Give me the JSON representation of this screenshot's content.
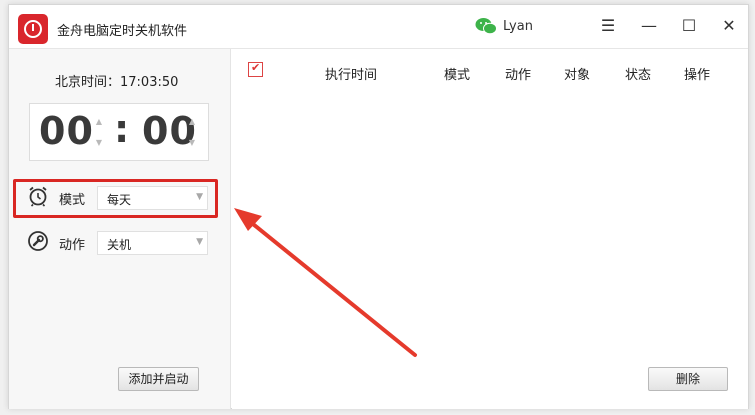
{
  "titlebar": {
    "app_title": "金舟电脑定时关机软件",
    "user_name": "Lyan",
    "icons": [
      "app-logo-icon",
      "wechat-icon",
      "menu-icon",
      "minimize-icon",
      "maximize-icon",
      "close-icon"
    ]
  },
  "left": {
    "beijing_time": "北京时间：17:03:50",
    "timer": {
      "hours": "00",
      "colon": ":",
      "minutes": "00"
    },
    "mode": {
      "label": "模式",
      "value": "每天",
      "icon": "alarm-clock-icon"
    },
    "action": {
      "label": "动作",
      "value": "关机",
      "icon": "wrench-icon"
    },
    "add_start_button": "添加并启动"
  },
  "table": {
    "columns": [
      "执行时间",
      "模式",
      "动作",
      "对象",
      "状态",
      "操作"
    ],
    "rows": [],
    "select_all_checked": true
  },
  "delete_button": "删除",
  "colors": {
    "accent_red": "#d92723",
    "wechat_green": "#3db34a",
    "logo_red": "#d9262c"
  }
}
